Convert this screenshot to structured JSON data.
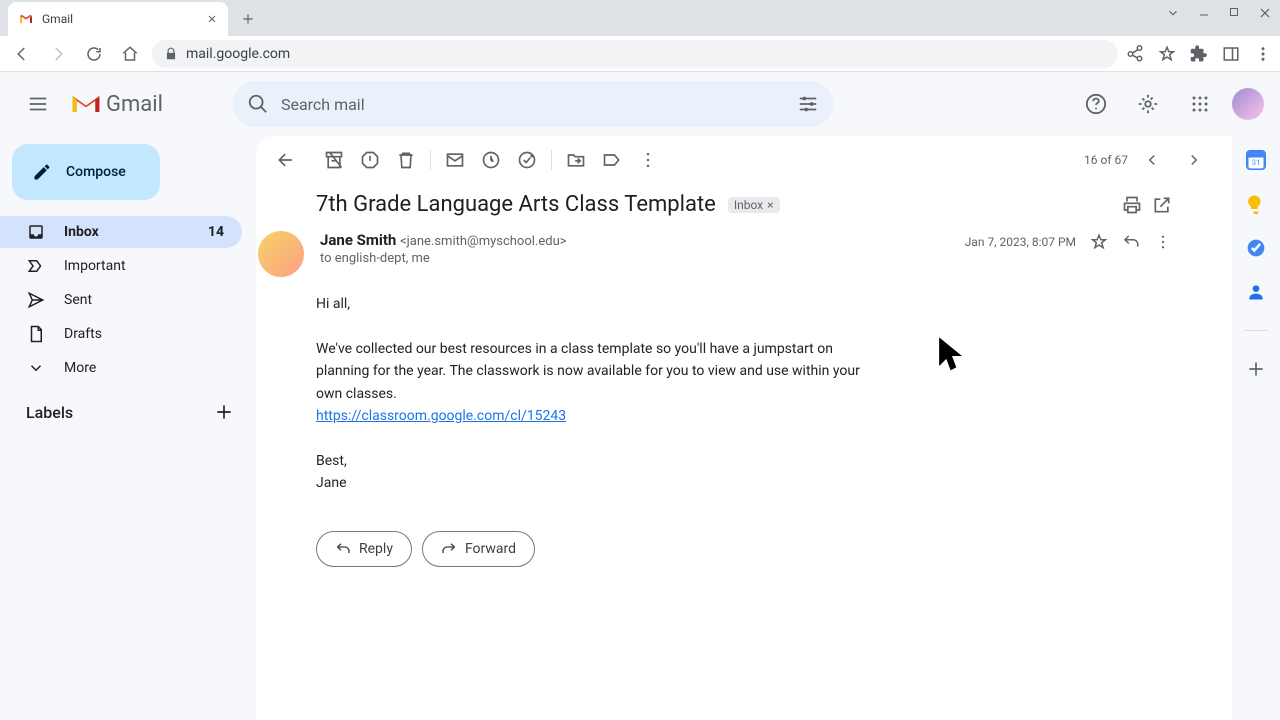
{
  "browser": {
    "tab_title": "Gmail",
    "url": "mail.google.com"
  },
  "app": {
    "logo_text": "Gmail",
    "search_placeholder": "Search mail"
  },
  "compose_label": "Compose",
  "sidebar": {
    "items": [
      {
        "label": "Inbox",
        "count": "14"
      },
      {
        "label": "Important"
      },
      {
        "label": "Sent"
      },
      {
        "label": "Drafts"
      },
      {
        "label": "More"
      }
    ],
    "labels_header": "Labels"
  },
  "pager": {
    "text": "16 of 67"
  },
  "message": {
    "subject": "7th Grade Language Arts Class Template",
    "inbox_tag": "Inbox",
    "sender_name": "Jane Smith",
    "sender_email": "<jane.smith@myschool.edu>",
    "to_line": "to english-dept, me",
    "date": "Jan 7, 2023, 8:07 PM",
    "greeting": "Hi all,",
    "p1": "We've collected our best resources in a class template so you'll have a jumpstart on planning for the year. The classwork is now available for you to view and use within your own classes.",
    "link": "https://classroom.google.com/cl/15243",
    "closing": "Best,",
    "signature": "Jane",
    "reply_label": "Reply",
    "forward_label": "Forward"
  }
}
